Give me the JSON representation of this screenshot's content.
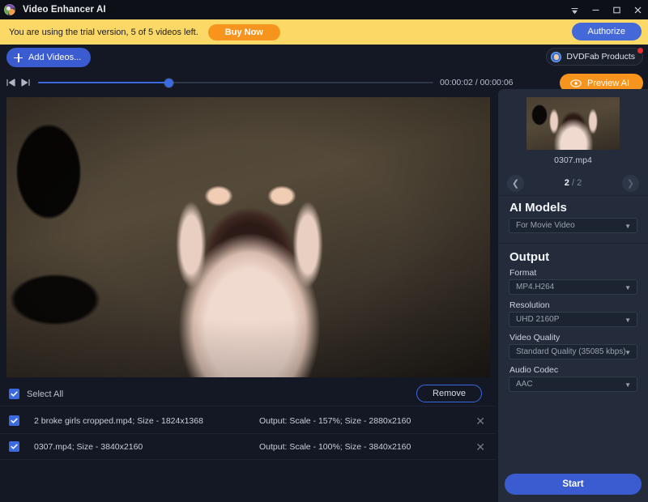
{
  "window": {
    "title": "Video Enhancer AI",
    "logo_icon": "app-logo-icon",
    "controls": [
      {
        "name": "pin-icon",
        "glyph": "pin"
      },
      {
        "name": "minimize-icon",
        "glyph": "minimize"
      },
      {
        "name": "maximize-icon",
        "glyph": "maximize"
      },
      {
        "name": "close-icon",
        "glyph": "close"
      }
    ]
  },
  "banner": {
    "text": "You are using the trial version, 5 of 5 videos left.",
    "buy_now_label": "Buy Now",
    "authorize_label": "Authorize",
    "bg_color": "#fcd967",
    "buy_now_color": "#f7941d",
    "authorize_color": "#4468d8"
  },
  "toolbar": {
    "add_videos_label": "Add Videos...",
    "add_videos_icon": "plus-icon",
    "dvdfab_label": "DVDFab Products",
    "dvdfab_icon": "dvdfab-icon",
    "dvdfab_badge": true
  },
  "player": {
    "prev_icon": "skip-previous-icon",
    "next_icon": "skip-next-icon",
    "timecode": "00:00:02 / 00:00:06",
    "current_time": "00:00:02",
    "total_time": "00:00:06",
    "progress_percent": 33,
    "preview_label": "Preview AI",
    "preview_icon": "eye-icon",
    "preview_color": "#f7941d"
  },
  "list": {
    "select_all_label": "Select All",
    "select_all_checked": true,
    "remove_label": "Remove",
    "rows": [
      {
        "checked": true,
        "name": "2 broke girls cropped.mp4; Size - 1824x1368",
        "output": "Output: Scale - 157%; Size - 2880x2160",
        "close_icon": "close-icon"
      },
      {
        "checked": true,
        "name": "0307.mp4; Size - 3840x2160",
        "output": "Output: Scale - 100%; Size - 3840x2160",
        "close_icon": "close-icon"
      }
    ]
  },
  "sidebar": {
    "thumbnail_name": "0307.mp4",
    "pager": {
      "current": "2",
      "separator": " / ",
      "total": "2",
      "prev_icon": "chevron-left-icon",
      "next_icon": "chevron-right-icon"
    },
    "ai_models": {
      "title": "AI Models",
      "model_value": "For Movie Video"
    },
    "output": {
      "title": "Output",
      "fields": [
        {
          "label": "Format",
          "value": "MP4.H264"
        },
        {
          "label": "Resolution",
          "value": "UHD 2160P"
        },
        {
          "label": "Video Quality",
          "value": "Standard Quality (35085 kbps)"
        },
        {
          "label": "Audio Codec",
          "value": "AAC"
        }
      ]
    },
    "start_label": "Start",
    "start_color": "#3b5cd0",
    "bg_color": "#242c3c"
  }
}
